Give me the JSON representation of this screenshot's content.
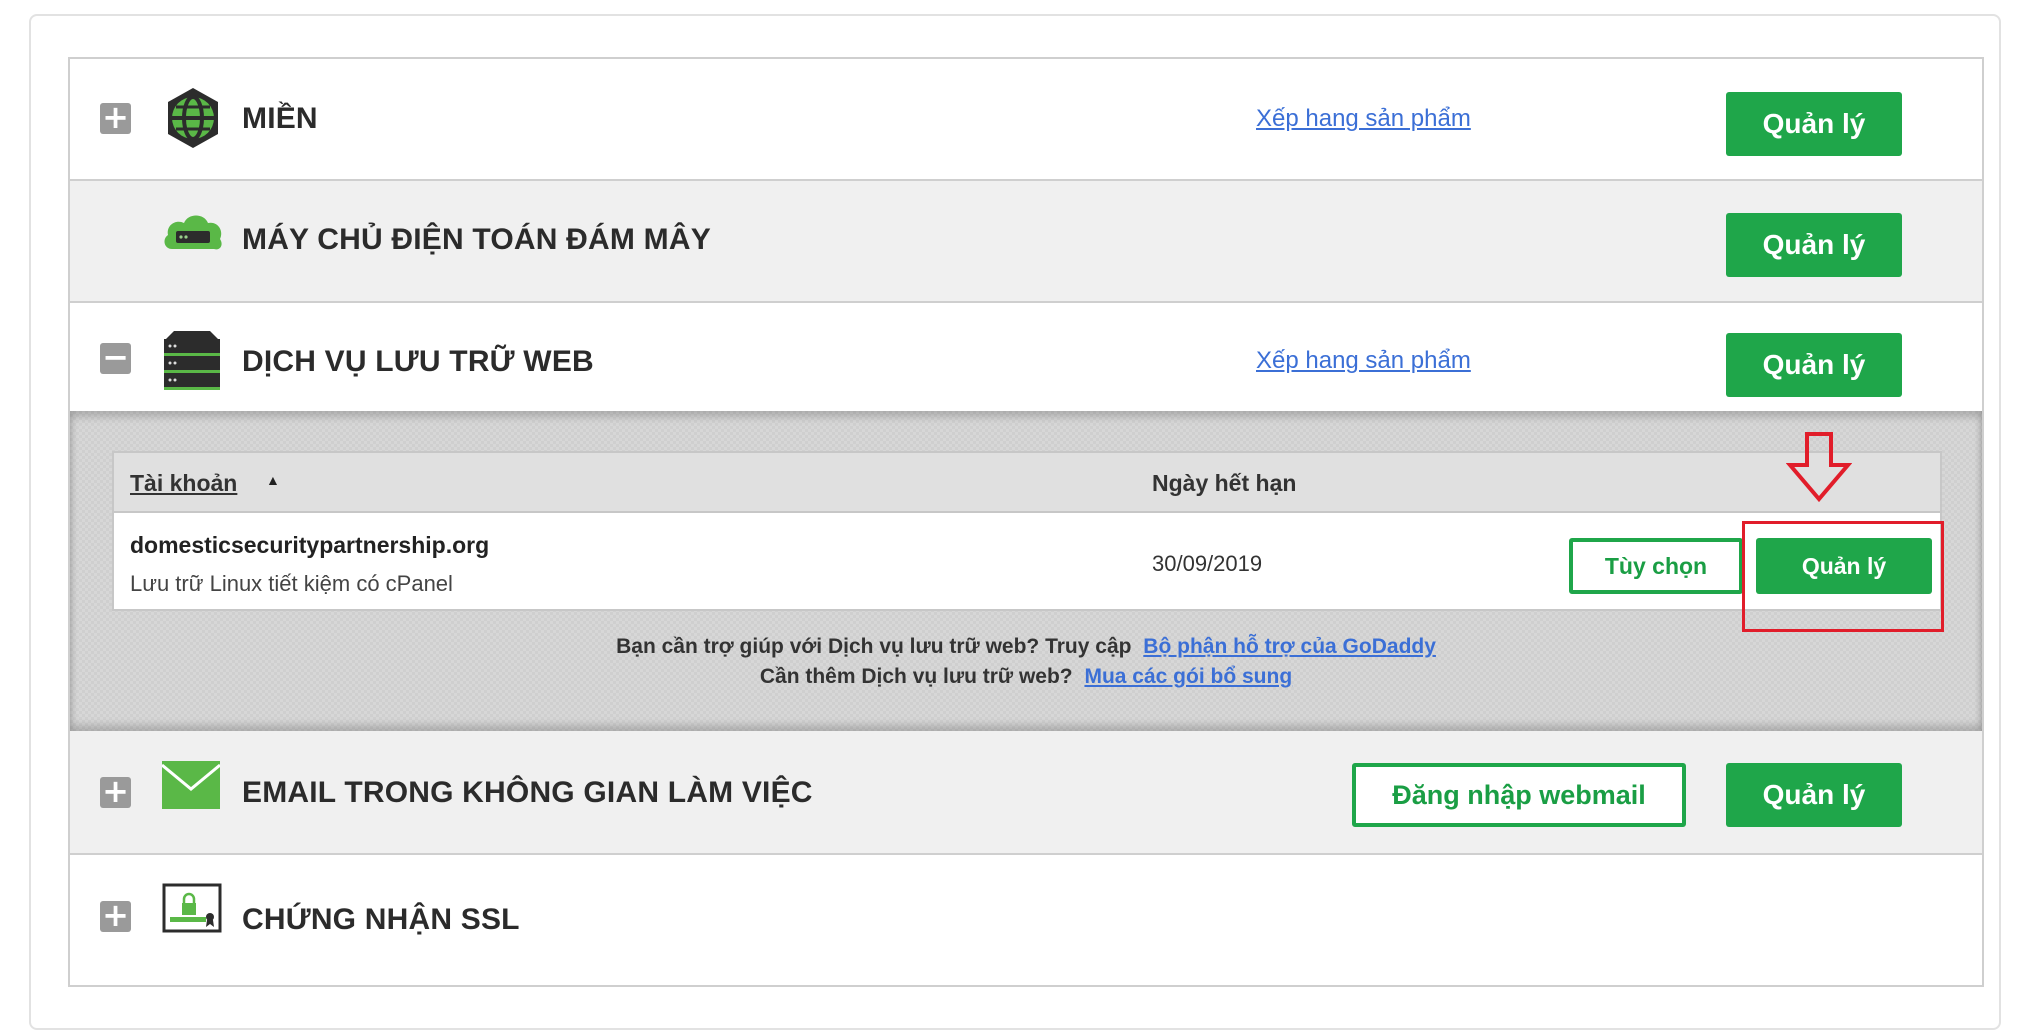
{
  "products": {
    "domains": {
      "title": "MIỀN",
      "rating_link": "Xếp hang sản phẩm",
      "manage_label": "Quản lý",
      "expander": "+"
    },
    "cloud": {
      "title": "MÁY CHỦ ĐIỆN TOÁN ĐÁM MÂY",
      "manage_label": "Quản lý"
    },
    "hosting": {
      "title": "DỊCH VỤ LƯU TRỮ WEB",
      "rating_link": "Xếp hang sản phẩm",
      "manage_label": "Quản lý",
      "expander": "−"
    },
    "email": {
      "title": "EMAIL TRONG KHÔNG GIAN LÀM VIỆC",
      "webmail_label": "Đăng nhập webmail",
      "manage_label": "Quản lý",
      "expander": "+"
    },
    "ssl": {
      "title": "CHỨNG NHẬN SSL",
      "expander": "+"
    }
  },
  "hosting_table": {
    "col_account": "Tài khoản",
    "sort_indicator": "▲",
    "col_expiry": "Ngày hết hạn",
    "rows": [
      {
        "domain": "domesticsecuritypartnership.org",
        "plan": "Lưu trữ Linux tiết kiệm có cPanel",
        "expiry": "30/09/2019",
        "options_label": "Tùy chọn",
        "manage_label": "Quản lý"
      }
    ]
  },
  "help": {
    "line1_text": "Bạn cần trợ giúp với Dịch vụ lưu trữ web? Truy cập",
    "line1_link": "Bộ phận hỗ trợ của GoDaddy",
    "line2_text": "Cần thêm Dịch vụ lưu trữ web?",
    "line2_link": "Mua các gói bổ sung"
  },
  "colors": {
    "accent_green": "#1fa64a",
    "link_blue": "#3b6fd6",
    "annotation_red": "#e11d2a"
  },
  "icons": {
    "domains": "globe-icon",
    "cloud": "cloud-server-icon",
    "hosting": "server-stack-icon",
    "email": "envelope-icon",
    "ssl": "certificate-lock-icon",
    "annotation": "down-arrow-annotation"
  }
}
